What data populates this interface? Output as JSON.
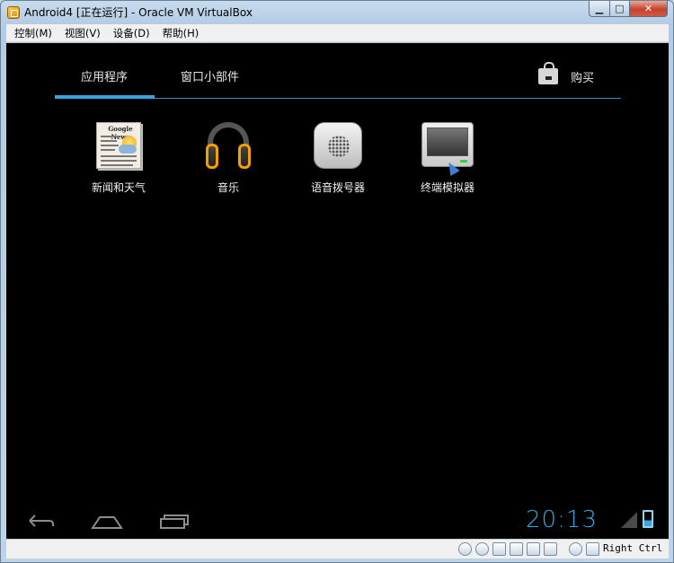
{
  "window": {
    "title": "Android4 [正在运行] - Oracle VM VirtualBox",
    "minimize_glyph": "▁",
    "maximize_glyph": "□",
    "close_glyph": "✕"
  },
  "menu": {
    "items": [
      "控制(M)",
      "视图(V)",
      "设备(D)",
      "帮助(H)"
    ]
  },
  "android": {
    "tabs": [
      {
        "label": "应用程序",
        "active": true
      },
      {
        "label": "窗口小部件",
        "active": false
      }
    ],
    "store_label": "购买",
    "store_icon": "shopping-bag-icon",
    "apps": [
      {
        "label": "新闻和天气",
        "icon": "news-weather-icon",
        "news_header": "Google News"
      },
      {
        "label": "音乐",
        "icon": "headphones-icon"
      },
      {
        "label": "语音拨号器",
        "icon": "voice-dialer-icon"
      },
      {
        "label": "终端模拟器",
        "icon": "terminal-icon"
      }
    ],
    "navbar": {
      "back_icon": "back-icon",
      "home_icon": "home-icon",
      "recent_icon": "recent-apps-icon"
    },
    "clock": "20:13",
    "accent_color": "#33a6dd"
  },
  "statusbar": {
    "host_key_label": "Right Ctrl"
  }
}
